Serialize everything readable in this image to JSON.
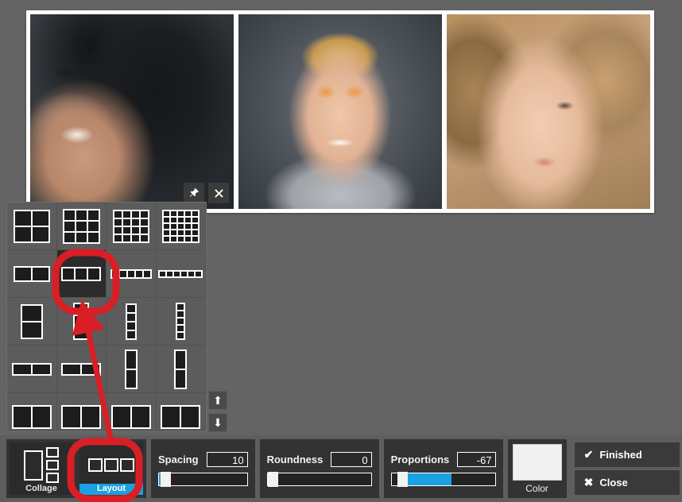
{
  "app": {
    "background_color": "#646464",
    "accent_color": "#1ba1e2",
    "panel_color": "#333333"
  },
  "canvas": {
    "collage": {
      "frame_color": "#ffffff",
      "photos": [
        {
          "name": "photo-woman-dark-curly-hair",
          "alt": "Laughing woman with dark curly hair"
        },
        {
          "name": "photo-man-orange-glasses",
          "alt": "Smiling blond man wearing orange glasses"
        },
        {
          "name": "photo-blonde-woman-portrait",
          "alt": "Blonde woman close-up portrait"
        }
      ]
    },
    "image_buttons": [
      {
        "name": "pin-icon",
        "glyph": "📌",
        "label": "Pin"
      },
      {
        "name": "close-icon",
        "glyph": "✖",
        "label": "Close"
      }
    ]
  },
  "layout_panel": {
    "selected_index": 5,
    "scroll_up_glyph": "⬆",
    "scroll_down_glyph": "⬇",
    "thumbs": [
      {
        "name": "layout-2x2",
        "cols": 2,
        "rows": 2,
        "cw": 20,
        "ch": 18
      },
      {
        "name": "layout-3x3",
        "cols": 3,
        "rows": 3,
        "cw": 13,
        "ch": 12
      },
      {
        "name": "layout-4x4",
        "cols": 4,
        "rows": 4,
        "cw": 9,
        "ch": 8
      },
      {
        "name": "layout-5x5",
        "cols": 5,
        "rows": 5,
        "cw": 7,
        "ch": 6
      },
      {
        "name": "layout-1x2-row",
        "cols": 2,
        "rows": 1,
        "cw": 20,
        "ch": 16
      },
      {
        "name": "layout-1x3-row",
        "cols": 3,
        "rows": 1,
        "cw": 14,
        "ch": 14
      },
      {
        "name": "layout-1x5-row",
        "cols": 5,
        "rows": 1,
        "cw": 8,
        "ch": 8
      },
      {
        "name": "layout-1x6-row",
        "cols": 6,
        "rows": 1,
        "cw": 7,
        "ch": 6
      },
      {
        "name": "layout-2x1-col",
        "cols": 1,
        "rows": 2,
        "cw": 24,
        "ch": 19
      },
      {
        "name": "layout-3x1-col",
        "cols": 1,
        "rows": 3,
        "cw": 16,
        "ch": 13
      },
      {
        "name": "layout-4x1-col",
        "cols": 1,
        "rows": 4,
        "cw": 10,
        "ch": 9
      },
      {
        "name": "layout-5x1-col",
        "cols": 1,
        "rows": 5,
        "cw": 8,
        "ch": 7
      },
      {
        "name": "layout-wide-2",
        "cols": 2,
        "rows": 1,
        "cw": 22,
        "ch": 12
      },
      {
        "name": "layout-wide-2b",
        "cols": 2,
        "rows": 1,
        "cw": 22,
        "ch": 12
      },
      {
        "name": "layout-tall-2",
        "cols": 1,
        "rows": 2,
        "cw": 12,
        "ch": 22
      },
      {
        "name": "layout-tall-2b",
        "cols": 1,
        "rows": 2,
        "cw": 12,
        "ch": 22
      },
      {
        "name": "layout-mixed-a",
        "cols": 2,
        "rows": 1,
        "cw": 22,
        "ch": 26
      },
      {
        "name": "layout-mixed-b",
        "cols": 2,
        "rows": 1,
        "cw": 22,
        "ch": 26
      },
      {
        "name": "layout-mixed-c",
        "cols": 2,
        "rows": 1,
        "cw": 22,
        "ch": 26
      },
      {
        "name": "layout-mixed-d",
        "cols": 2,
        "rows": 1,
        "cw": 22,
        "ch": 26
      }
    ]
  },
  "toolbar": {
    "modes": [
      {
        "name": "collage",
        "label": "Collage",
        "active": false
      },
      {
        "name": "layout",
        "label": "Layout",
        "active": true
      }
    ],
    "sliders": [
      {
        "name": "spacing",
        "label": "Spacing",
        "value": "10",
        "fill_pct": 4,
        "knob_pct": 2
      },
      {
        "name": "roundness",
        "label": "Roundness",
        "value": "0",
        "fill_pct": 0,
        "knob_pct": 0
      },
      {
        "name": "proportions",
        "label": "Proportions",
        "value": "-67",
        "fill_pct": 50,
        "knob_pct": 6
      }
    ],
    "color": {
      "label": "Color",
      "swatch": "#f1f1f1"
    },
    "actions": [
      {
        "name": "finished",
        "label": "Finished",
        "glyph": "✔"
      },
      {
        "name": "close",
        "label": "Close",
        "glyph": "✖"
      }
    ]
  },
  "annotations": {
    "highlight_color": "#d81f26",
    "circle_target": "layout-1x3-row-thumbnail",
    "arrow_from": "layout-mode-button",
    "arrow_to": "layout-1x3-row-thumbnail"
  }
}
